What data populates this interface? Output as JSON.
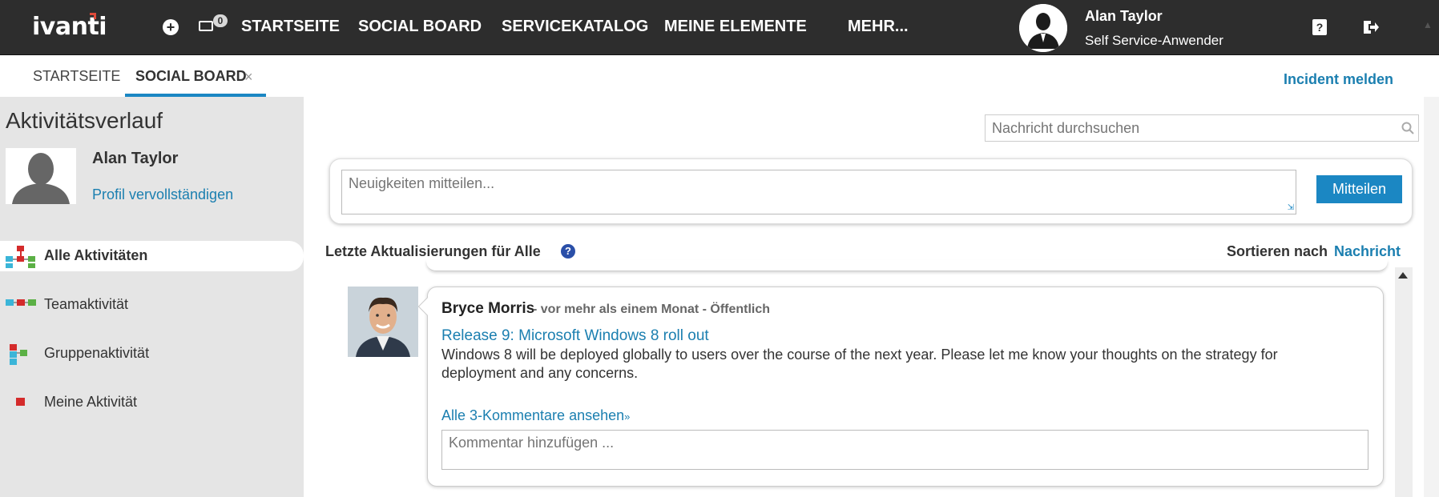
{
  "topbar": {
    "logo": "ivanti",
    "chat_badge": "0",
    "nav": [
      "STARTSEITE",
      "SOCIAL BOARD",
      "SERVICEKATALOG",
      "MEINE ELEMENTE",
      "MEHR..."
    ],
    "user_name": "Alan Taylor",
    "user_role": "Self Service-Anwender",
    "help_glyph": "?"
  },
  "tabs": {
    "items": [
      "STARTSEITE",
      "SOCIAL BOARD"
    ],
    "close_glyph": "×",
    "incident_link": "Incident melden"
  },
  "sidebar": {
    "title": "Aktivitätsverlauf",
    "user_name": "Alan Taylor",
    "profile_link": "Profil vervollständigen",
    "items": [
      {
        "label": "Alle Aktivitäten",
        "icon": "all-activities-icon"
      },
      {
        "label": "Teamaktivität",
        "icon": "team-activity-icon"
      },
      {
        "label": "Gruppenaktivität",
        "icon": "group-activity-icon"
      },
      {
        "label": "Meine Aktivität",
        "icon": "my-activity-icon"
      }
    ]
  },
  "main": {
    "search_placeholder": "Nachricht durchsuchen",
    "share_placeholder": "Neuigkeiten mitteilen...",
    "share_button": "Mitteilen",
    "updates_title": "Letzte Aktualisierungen für Alle",
    "help_glyph": "?",
    "sort_label": "Sortieren nach",
    "sort_value": "Nachricht",
    "post": {
      "author": "Bryce Morris",
      "meta": "- vor mehr als einem Monat - Öffentlich",
      "title": "Release 9: Microsoft Windows 8 roll out",
      "body": "Windows 8 will be deployed globally to users over the course of the next year. Please let me know your thoughts on the strategy for deployment and any concerns.",
      "comments_link": "Alle 3-Kommentare ansehen",
      "comment_placeholder": "Kommentar hinzufügen ..."
    }
  },
  "colors": {
    "topbar": "#2d2d2d",
    "accent": "#1b87c3",
    "link": "#1b7fb0",
    "sidebar": "#e5e5e5"
  }
}
